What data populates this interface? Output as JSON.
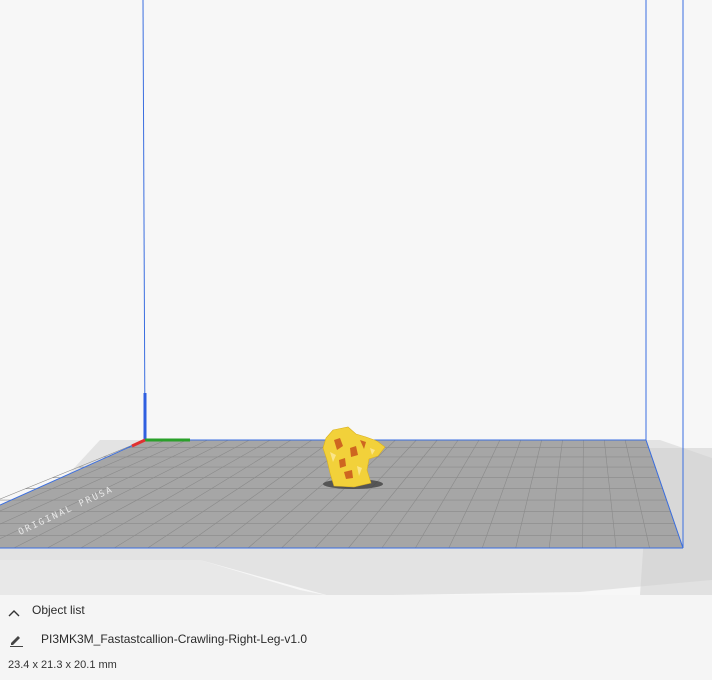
{
  "viewport": {
    "build_plate_text": "ORIGINAL PRUSA",
    "volume_outline_color": "#3a6ee0",
    "plate_grid_color": "#8a8a8a",
    "plate_color": "#a6a6a6",
    "model_color": "#f2d13a",
    "model_shade_color": "#c8541c",
    "axis_colors": {
      "x": "#e03030",
      "y": "#2aa02a",
      "z": "#2f5fe0"
    }
  },
  "object_list": {
    "toggle_icon": "chevron-up-icon",
    "title": "Object list",
    "items": [
      {
        "icon": "pencil-icon",
        "name": "PI3MK3M_Fastastcallion-Crawling-Right-Leg-v1.0"
      }
    ],
    "dimensions": "23.4 x 21.3 x 20.1 mm"
  }
}
